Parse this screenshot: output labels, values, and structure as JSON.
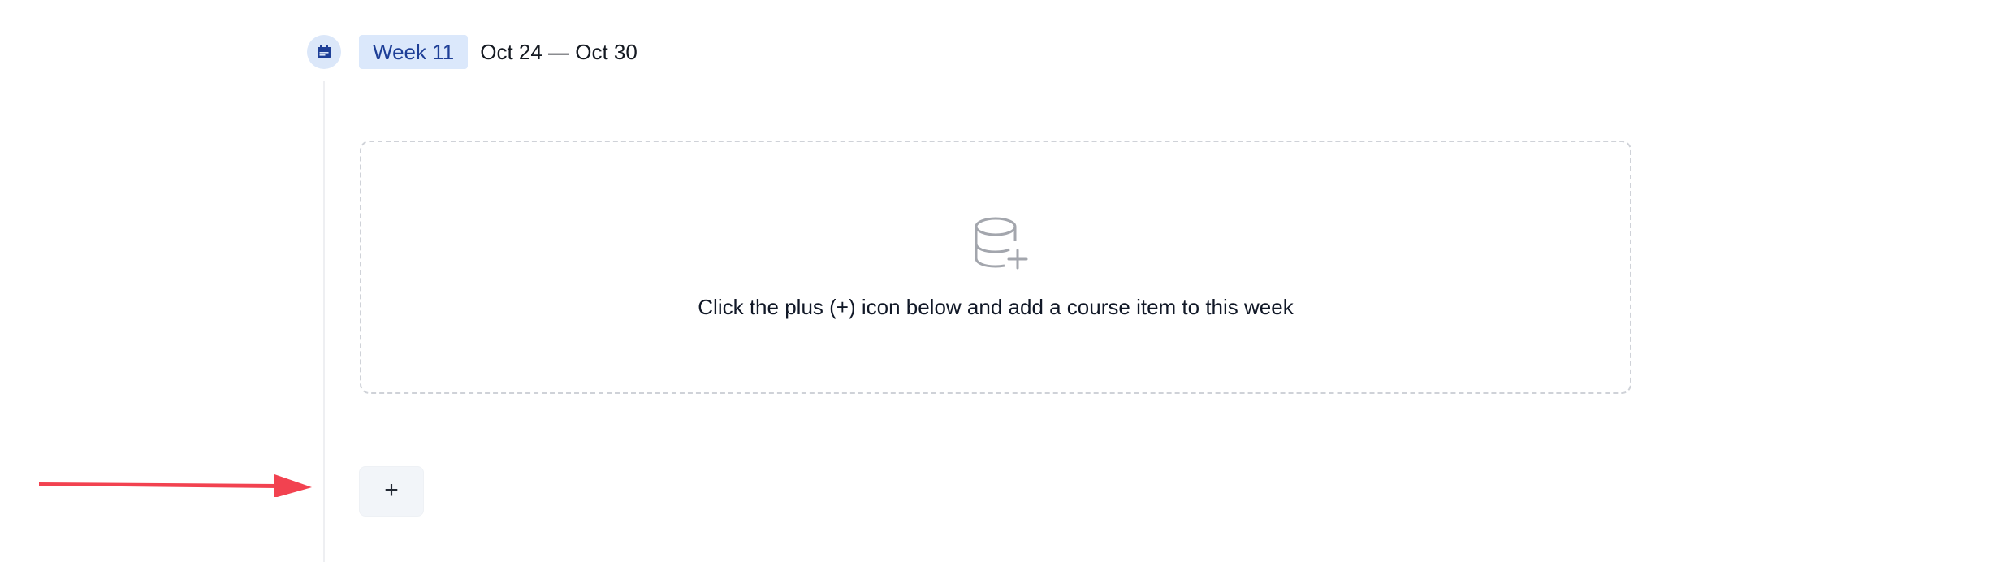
{
  "week": {
    "label": "Week 11",
    "date_range": "Oct 24 — Oct 30"
  },
  "empty_state": {
    "message": "Click the plus (+) icon below and add a course item to this week"
  },
  "add_button": {
    "label": "+"
  },
  "icons": {
    "calendar": "calendar-icon",
    "database_add": "database-add-icon",
    "annotation_arrow": "red-arrow-annotation"
  },
  "colors": {
    "accent_blue": "#1e3f97",
    "pill_background": "#dbe8fb",
    "annotation_red": "#f24250",
    "icon_gray": "#a3a6ad"
  }
}
